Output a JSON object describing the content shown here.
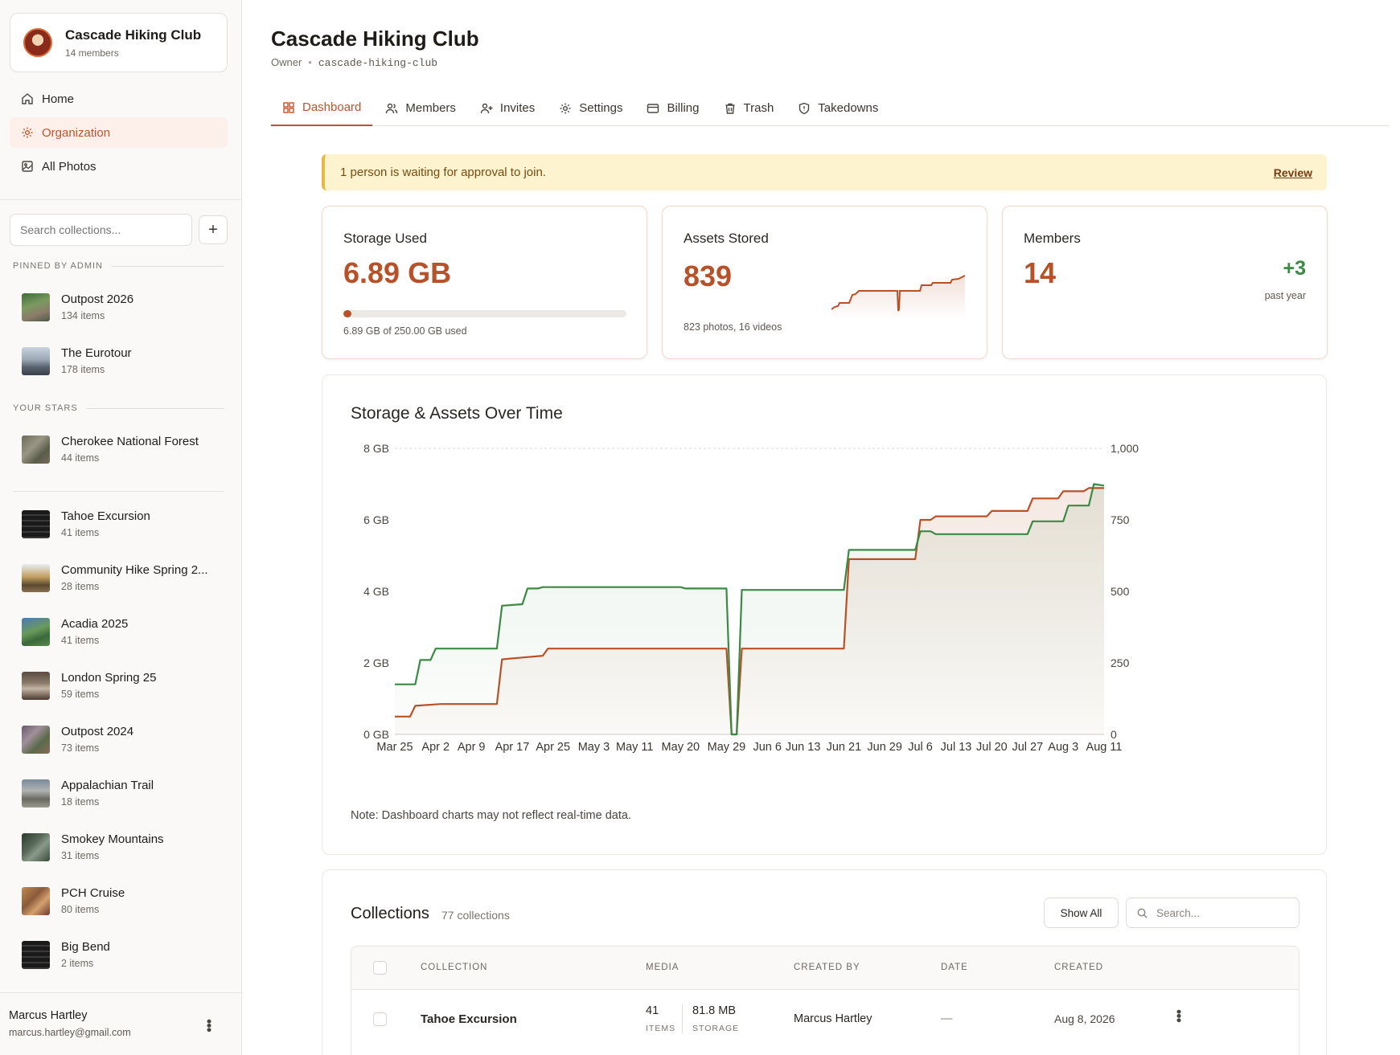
{
  "sidebar": {
    "org_name": "Cascade Hiking Club",
    "org_members": "14 members",
    "nav": [
      {
        "label": "Home",
        "icon": "home-icon"
      },
      {
        "label": "Organization",
        "icon": "gear-icon"
      },
      {
        "label": "All Photos",
        "icon": "image-icon"
      }
    ],
    "search_placeholder": "Search collections...",
    "pinned_label": "PINNED BY ADMIN",
    "stars_label": "YOUR STARS",
    "pinned": [
      {
        "name": "Outpost 2026",
        "count": "134 items"
      },
      {
        "name": "The Eurotour",
        "count": "178 items"
      }
    ],
    "stars": [
      {
        "name": "Cherokee National Forest",
        "count": "44 items"
      }
    ],
    "collections": [
      {
        "name": "Tahoe Excursion",
        "count": "41 items"
      },
      {
        "name": "Community Hike Spring 2...",
        "count": "28 items"
      },
      {
        "name": "Acadia 2025",
        "count": "41 items"
      },
      {
        "name": "London Spring 25",
        "count": "59 items"
      },
      {
        "name": "Outpost 2024",
        "count": "73 items"
      },
      {
        "name": "Appalachian Trail",
        "count": "18 items"
      },
      {
        "name": "Smokey Mountains",
        "count": "31 items"
      },
      {
        "name": "PCH Cruise",
        "count": "80 items"
      },
      {
        "name": "Big Bend",
        "count": "2 items"
      }
    ],
    "user_name": "Marcus Hartley",
    "user_email": "marcus.hartley@gmail.com"
  },
  "header": {
    "title": "Cascade Hiking Club",
    "role": "Owner",
    "slug": "cascade-hiking-club"
  },
  "tabs": [
    {
      "label": "Dashboard",
      "icon": "grid-icon"
    },
    {
      "label": "Members",
      "icon": "users-icon"
    },
    {
      "label": "Invites",
      "icon": "user-plus-icon"
    },
    {
      "label": "Settings",
      "icon": "gear-icon"
    },
    {
      "label": "Billing",
      "icon": "card-icon"
    },
    {
      "label": "Trash",
      "icon": "trash-icon"
    },
    {
      "label": "Takedowns",
      "icon": "shield-icon"
    }
  ],
  "banner": {
    "text": "1 person is waiting for approval to join.",
    "action": "Review"
  },
  "stats": {
    "storage": {
      "label": "Storage Used",
      "value": "6.89 GB",
      "detail": "6.89 GB of 250.00 GB used",
      "used_fraction": 0.0276
    },
    "assets": {
      "label": "Assets Stored",
      "value": "839",
      "detail": "823 photos, 16 videos"
    },
    "members": {
      "label": "Members",
      "value": "14",
      "delta": "+3",
      "delta_label": "past year"
    }
  },
  "chart_title": "Storage & Assets Over Time",
  "chart_note": "Note: Dashboard charts may not reflect real-time data.",
  "chart_data": {
    "type": "line",
    "title": "Storage & Assets Over Time",
    "x_tick_labels": [
      "Mar 25",
      "Apr 2",
      "Apr 9",
      "Apr 17",
      "Apr 25",
      "May 3",
      "May 11",
      "May 20",
      "May 29",
      "Jun 6",
      "Jun 13",
      "Jun 21",
      "Jun 29",
      "Jul 6",
      "Jul 13",
      "Jul 20",
      "Jul 27",
      "Aug 3",
      "Aug 11"
    ],
    "y_left": {
      "ticks": [
        "0 GB",
        "2 GB",
        "4 GB",
        "6 GB",
        "8 GB"
      ],
      "range": [
        0,
        8
      ],
      "unit": "GB"
    },
    "y_right": {
      "ticks": [
        "0",
        "250",
        "500",
        "750",
        "1,000"
      ],
      "range": [
        0,
        1000
      ]
    },
    "grid": "dashed top line",
    "series": [
      {
        "axis": "left",
        "color": "#b85028",
        "x": [
          "Mar 25",
          "Mar 28",
          "Mar 29",
          "Apr 3",
          "Apr 14",
          "Apr 15",
          "Apr 19",
          "Apr 23",
          "Apr 24",
          "May 29",
          "May 30",
          "May 31",
          "Jun 1",
          "Jun 21",
          "Jun 22",
          "Jul 5",
          "Jul 6",
          "Jul 8",
          "Jul 9",
          "Jul 19",
          "Jul 20",
          "Jul 27",
          "Jul 28",
          "Aug 2",
          "Aug 3",
          "Aug 7",
          "Aug 8",
          "Aug 11"
        ],
        "values": [
          0.5,
          0.5,
          0.8,
          0.85,
          0.85,
          2.1,
          2.15,
          2.2,
          2.4,
          2.4,
          0,
          0,
          2.4,
          2.4,
          4.9,
          4.9,
          6.0,
          6.0,
          6.1,
          6.1,
          6.25,
          6.25,
          6.6,
          6.6,
          6.8,
          6.8,
          6.89,
          6.89
        ]
      },
      {
        "axis": "right",
        "color": "#3a8a44",
        "x": [
          "Mar 25",
          "Mar 29",
          "Mar 30",
          "Apr 1",
          "Apr 2",
          "Apr 14",
          "Apr 15",
          "Apr 19",
          "Apr 20",
          "Apr 22",
          "Apr 23",
          "May 20",
          "May 21",
          "May 29",
          "May 30",
          "May 31",
          "Jun 1",
          "Jun 21",
          "Jun 22",
          "Jul 5",
          "Jul 6",
          "Jul 8",
          "Jul 9",
          "Jul 27",
          "Jul 28",
          "Aug 3",
          "Aug 4",
          "Aug 8",
          "Aug 9",
          "Aug 11"
        ],
        "values": [
          175,
          175,
          260,
          260,
          300,
          300,
          450,
          455,
          510,
          510,
          515,
          515,
          510,
          510,
          0,
          0,
          505,
          505,
          645,
          645,
          710,
          710,
          700,
          700,
          745,
          745,
          800,
          800,
          875,
          870
        ]
      }
    ]
  },
  "collections_panel": {
    "title": "Collections",
    "count": "77 collections",
    "show_all": "Show All",
    "search_placeholder": "Search...",
    "columns": [
      "COLLECTION",
      "MEDIA",
      "CREATED BY",
      "DATE",
      "CREATED"
    ],
    "rows": [
      {
        "name": "Tahoe Excursion",
        "items": "41",
        "items_label": "ITEMS",
        "storage": "81.8 MB",
        "storage_label": "STORAGE",
        "created_by": "Marcus Hartley",
        "date": "—",
        "created": "Aug 8, 2026"
      }
    ]
  },
  "colors": {
    "accent": "#c0532b",
    "positive": "#3a8a44",
    "banner": "#fdf3cf"
  }
}
